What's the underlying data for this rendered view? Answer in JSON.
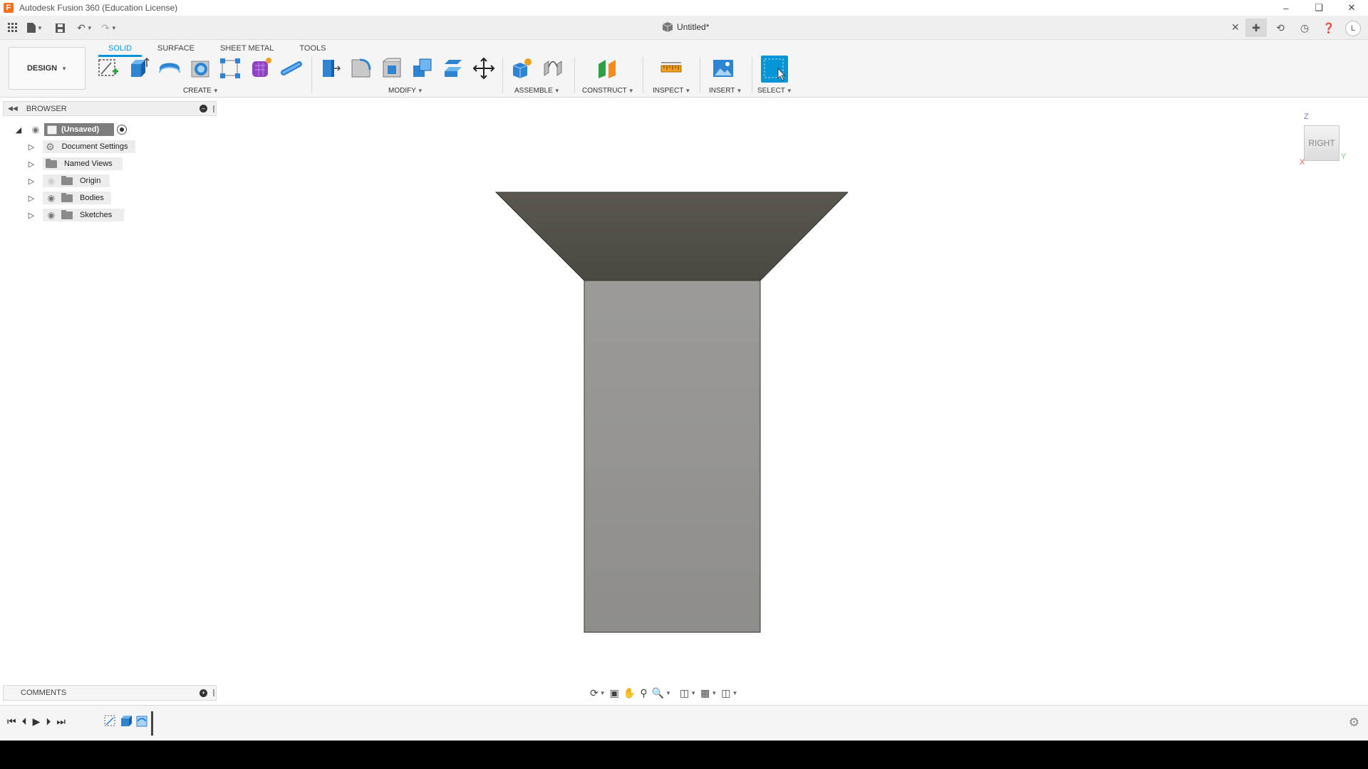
{
  "window": {
    "title": "Autodesk Fusion 360 (Education License)",
    "logo_letter": "F"
  },
  "document": {
    "title": "Untitled*"
  },
  "user": {
    "initial": "L"
  },
  "workspace": {
    "label": "DESIGN"
  },
  "toolbar": {
    "tabs": [
      "SOLID",
      "SURFACE",
      "SHEET METAL",
      "TOOLS"
    ],
    "groups": {
      "create": "CREATE",
      "modify": "MODIFY",
      "assemble": "ASSEMBLE",
      "construct": "CONSTRUCT",
      "inspect": "INSPECT",
      "insert": "INSERT",
      "select": "SELECT"
    }
  },
  "browser": {
    "title": "BROWSER",
    "root": "(Unsaved)",
    "items": [
      "Document Settings",
      "Named Views",
      "Origin",
      "Bodies",
      "Sketches"
    ]
  },
  "comments": {
    "title": "COMMENTS"
  },
  "viewcube": {
    "face": "RIGHT",
    "z": "Z",
    "y": "Y",
    "x": "X"
  },
  "colors": {
    "accent": "#0696d7",
    "funnel_top": "#545149",
    "funnel_stem": "#969591"
  }
}
